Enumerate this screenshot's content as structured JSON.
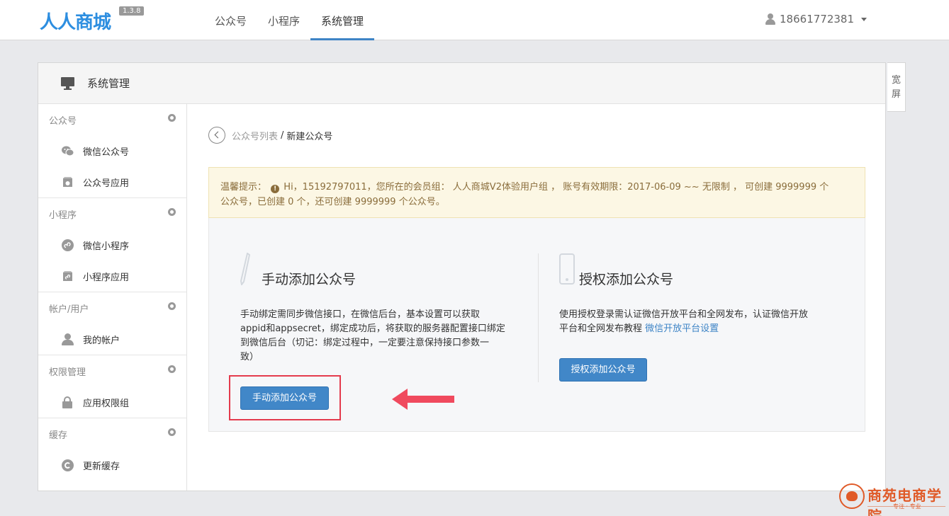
{
  "app": {
    "logo": "人人商城",
    "version": "1.3.8"
  },
  "nav": {
    "items": [
      {
        "label": "公众号"
      },
      {
        "label": "小程序"
      },
      {
        "label": "系统管理"
      }
    ],
    "active_index": 2
  },
  "user": {
    "name": "18661772381"
  },
  "panel": {
    "title": "系统管理"
  },
  "wide_tab": {
    "label": "宽屏"
  },
  "sidebar": {
    "groups": [
      {
        "title": "公众号",
        "items": [
          {
            "label": "微信公众号",
            "icon": "wechat-icon"
          },
          {
            "label": "公众号应用",
            "icon": "app-icon"
          }
        ]
      },
      {
        "title": "小程序",
        "items": [
          {
            "label": "微信小程序",
            "icon": "miniprogram-icon"
          },
          {
            "label": "小程序应用",
            "icon": "app-icon"
          }
        ]
      },
      {
        "title": "帐户/用户",
        "items": [
          {
            "label": "我的帐户",
            "icon": "user-icon"
          }
        ]
      },
      {
        "title": "权限管理",
        "items": [
          {
            "label": "应用权限组",
            "icon": "lock-icon"
          }
        ]
      },
      {
        "title": "缓存",
        "items": [
          {
            "label": "更新缓存",
            "icon": "refresh-icon"
          }
        ]
      }
    ]
  },
  "breadcrumb": {
    "parent": "公众号列表",
    "separator": "/",
    "current": "新建公众号"
  },
  "tip": {
    "label": "温馨提示：",
    "line1": "Hi，15192797011，您所在的会员组： 人人商城V2体验用户组 ， 账号有效期限：2017-06-09 ~~ 无限制 ， 可创建 9999999 个",
    "line2": "公众号，已创建 0 个，还可创建 9999999 个公众号。"
  },
  "manual": {
    "title": "手动添加公众号",
    "desc_line1": "手动绑定需同步微信接口，在微信后台，基本设置可以获取",
    "desc_line2": "appid和appsecret，绑定成功后，将获取的服务器配置接口绑定",
    "desc_line3": "到微信后台（切记：绑定过程中，一定要注意保持接口参数一",
    "desc_line4": "致）",
    "button": "手动添加公众号"
  },
  "auth": {
    "title": "授权添加公众号",
    "desc_line1": "使用授权登录需认证微信开放平台和全网发布，认证微信开放",
    "desc_line2": "平台和全网发布教程 ",
    "link": "微信开放平台设置",
    "button": "授权添加公众号"
  },
  "watermark": {
    "name": "商苑电商学院",
    "sub": "专注 · 专业"
  },
  "colors": {
    "accent": "#3e84c6",
    "button": "#4187c8",
    "highlight": "#e43b4d",
    "tip_bg": "#fcf7e4",
    "tip_text": "#8a6d3b"
  }
}
